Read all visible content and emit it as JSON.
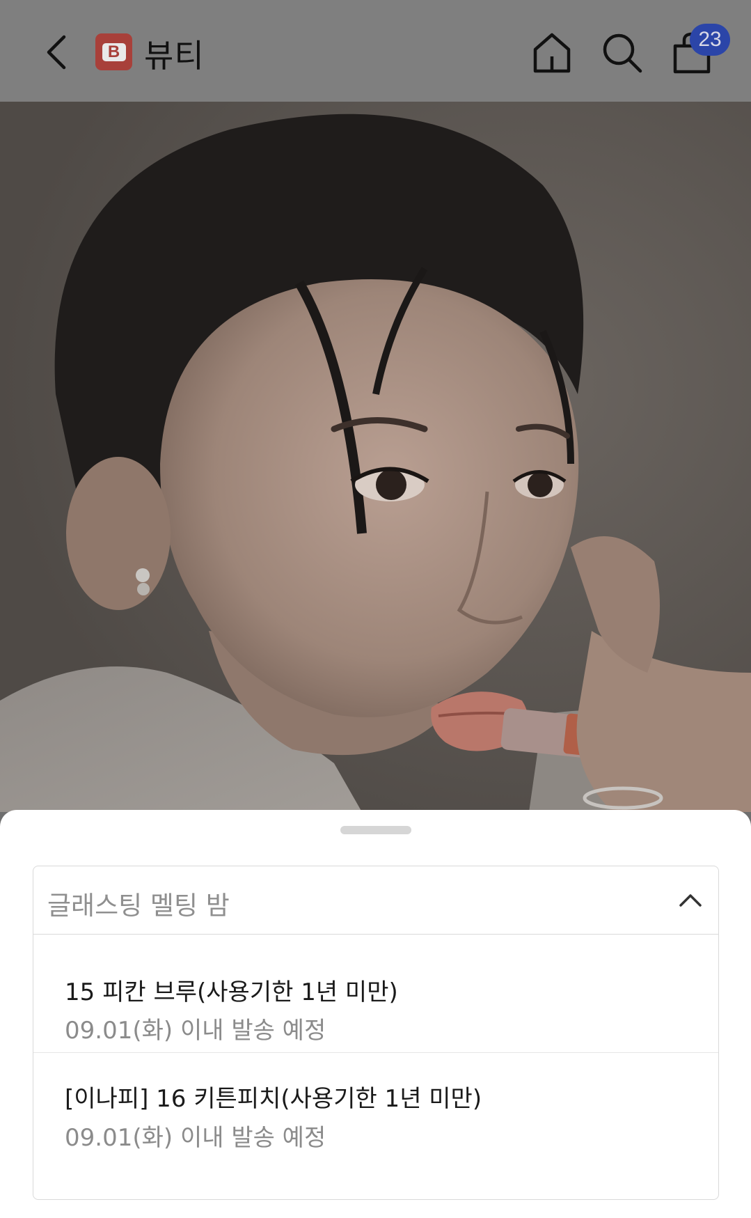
{
  "header": {
    "brand_logo_letter": "B",
    "brand_title": "뷰티",
    "cart_count": "23"
  },
  "sheet": {
    "dropdown_title": "글래스팅 멜팅 밤",
    "options": [
      {
        "name": "15 피칸 브루(사용기한 1년 미만)",
        "shipping": "09.01(화) 이내 발송 예정"
      },
      {
        "name": "[이나피] 16 키튼피치(사용기한 1년 미만)",
        "shipping": "09.01(화) 이내 발송 예정"
      }
    ]
  },
  "colors": {
    "header_bg": "#7f7f7f",
    "logo_bg": "#a8403a",
    "badge_bg": "#2b45a8"
  }
}
